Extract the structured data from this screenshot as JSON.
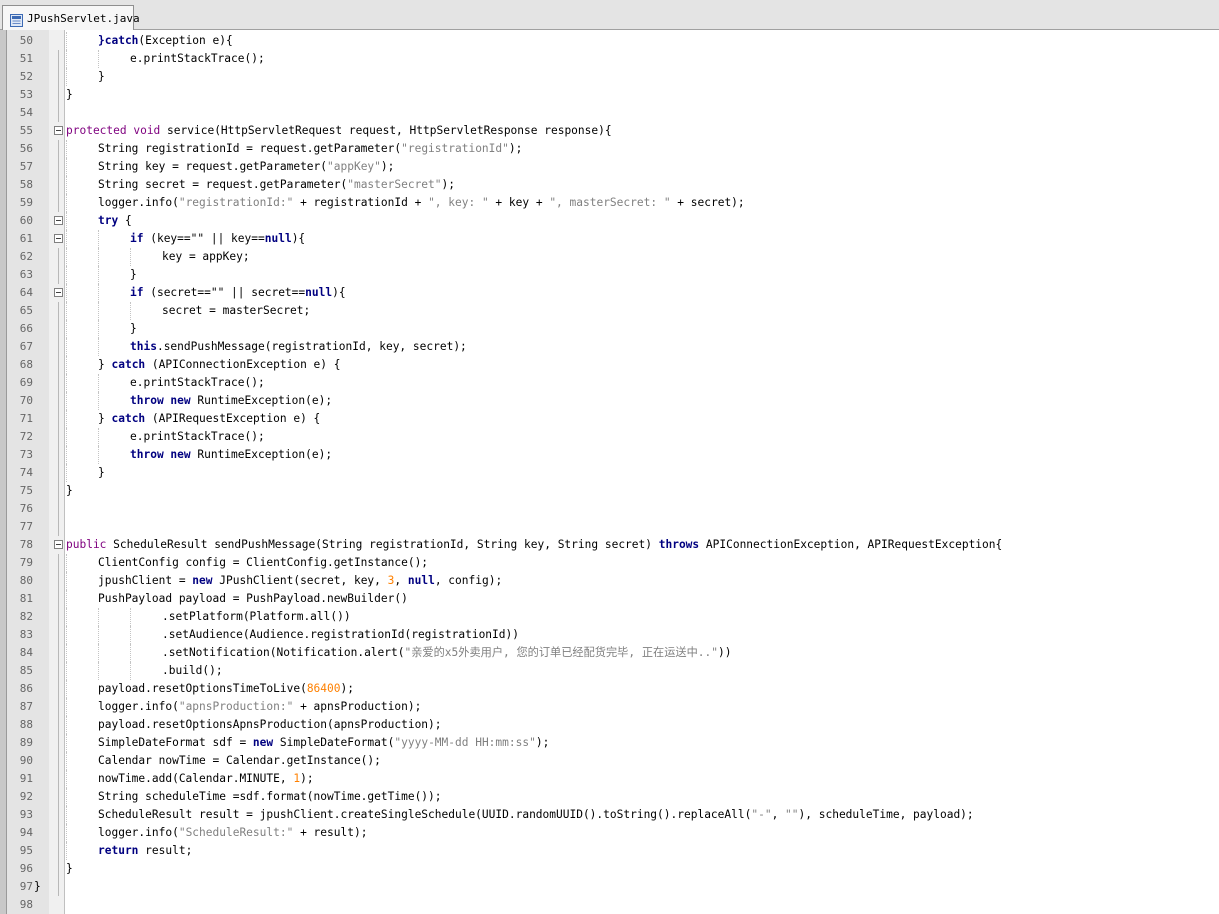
{
  "tab": {
    "label": "JPushServlet.java",
    "icon": "java-file-icon"
  },
  "colors": {
    "keyword": "#000080",
    "modifier": "#7f007f",
    "string": "#808080",
    "number": "#ff8000"
  },
  "lines": [
    {
      "num": "50",
      "indent": 2,
      "segments": [
        [
          "k",
          "}catch"
        ],
        [
          "",
          "(Exception e){"
        ]
      ]
    },
    {
      "num": "51",
      "indent": 3,
      "segments": [
        [
          "",
          "e.printStackTrace();"
        ]
      ]
    },
    {
      "num": "52",
      "indent": 2,
      "segments": [
        [
          "",
          "}"
        ]
      ]
    },
    {
      "num": "53",
      "indent": 1,
      "segments": [
        [
          "",
          "}"
        ]
      ]
    },
    {
      "num": "54",
      "indent": 0,
      "segments": []
    },
    {
      "num": "55",
      "indent": 1,
      "fold": true,
      "segments": [
        [
          "p",
          "protected void "
        ],
        [
          "",
          "service(HttpServletRequest request, HttpServletResponse response){"
        ]
      ]
    },
    {
      "num": "56",
      "indent": 2,
      "segments": [
        [
          "",
          "String registrationId = request.getParameter("
        ],
        [
          "s",
          "\"registrationId\""
        ],
        [
          "",
          ");"
        ]
      ]
    },
    {
      "num": "57",
      "indent": 2,
      "segments": [
        [
          "",
          "String key = request.getParameter("
        ],
        [
          "s",
          "\"appKey\""
        ],
        [
          "",
          ");"
        ]
      ]
    },
    {
      "num": "58",
      "indent": 2,
      "segments": [
        [
          "",
          "String secret = request.getParameter("
        ],
        [
          "s",
          "\"masterSecret\""
        ],
        [
          "",
          ");"
        ]
      ]
    },
    {
      "num": "59",
      "indent": 2,
      "segments": [
        [
          "",
          "logger.info("
        ],
        [
          "s",
          "\"registrationId:\""
        ],
        [
          "",
          " + registrationId + "
        ],
        [
          "s",
          "\", key: \""
        ],
        [
          "",
          " + key + "
        ],
        [
          "s",
          "\", masterSecret: \""
        ],
        [
          "",
          " + secret);"
        ]
      ]
    },
    {
      "num": "60",
      "indent": 2,
      "fold": true,
      "segments": [
        [
          "k",
          "try"
        ],
        [
          "",
          " {"
        ]
      ]
    },
    {
      "num": "61",
      "indent": 3,
      "fold": true,
      "segments": [
        [
          "k",
          "if"
        ],
        [
          "",
          " (key==\"\" || key=="
        ],
        [
          "k",
          "null"
        ],
        [
          "",
          "){"
        ]
      ]
    },
    {
      "num": "62",
      "indent": 4,
      "segments": [
        [
          "",
          "key = appKey;"
        ]
      ]
    },
    {
      "num": "63",
      "indent": 3,
      "segments": [
        [
          "",
          "}"
        ]
      ]
    },
    {
      "num": "64",
      "indent": 3,
      "fold": true,
      "segments": [
        [
          "k",
          "if"
        ],
        [
          "",
          " (secret==\"\" || secret=="
        ],
        [
          "k",
          "null"
        ],
        [
          "",
          "){"
        ]
      ]
    },
    {
      "num": "65",
      "indent": 4,
      "segments": [
        [
          "",
          "secret = masterSecret;"
        ]
      ]
    },
    {
      "num": "66",
      "indent": 3,
      "segments": [
        [
          "",
          "}"
        ]
      ]
    },
    {
      "num": "67",
      "indent": 3,
      "segments": [
        [
          "k",
          "this"
        ],
        [
          "",
          ".sendPushMessage(registrationId, key, secret);"
        ]
      ]
    },
    {
      "num": "68",
      "indent": 2,
      "segments": [
        [
          "",
          "} "
        ],
        [
          "k",
          "catch"
        ],
        [
          "",
          " (APIConnectionException e) {"
        ]
      ]
    },
    {
      "num": "69",
      "indent": 3,
      "segments": [
        [
          "",
          "e.printStackTrace();"
        ]
      ]
    },
    {
      "num": "70",
      "indent": 3,
      "segments": [
        [
          "k",
          "throw new "
        ],
        [
          "",
          "RuntimeException(e);"
        ]
      ]
    },
    {
      "num": "71",
      "indent": 2,
      "segments": [
        [
          "",
          "} "
        ],
        [
          "k",
          "catch"
        ],
        [
          "",
          " (APIRequestException e) {"
        ]
      ]
    },
    {
      "num": "72",
      "indent": 3,
      "segments": [
        [
          "",
          "e.printStackTrace();"
        ]
      ]
    },
    {
      "num": "73",
      "indent": 3,
      "segments": [
        [
          "k",
          "throw new "
        ],
        [
          "",
          "RuntimeException(e);"
        ]
      ]
    },
    {
      "num": "74",
      "indent": 2,
      "segments": [
        [
          "",
          "}"
        ]
      ]
    },
    {
      "num": "75",
      "indent": 1,
      "segments": [
        [
          "",
          "}"
        ]
      ]
    },
    {
      "num": "76",
      "indent": 0,
      "segments": []
    },
    {
      "num": "77",
      "indent": 0,
      "segments": []
    },
    {
      "num": "78",
      "indent": 1,
      "fold": true,
      "segments": [
        [
          "p",
          "public "
        ],
        [
          "",
          "ScheduleResult sendPushMessage(String registrationId, String key, String secret) "
        ],
        [
          "k",
          "throws"
        ],
        [
          "",
          " APIConnectionException, APIRequestException{"
        ]
      ]
    },
    {
      "num": "79",
      "indent": 2,
      "segments": [
        [
          "",
          "ClientConfig config = ClientConfig.getInstance();"
        ]
      ]
    },
    {
      "num": "80",
      "indent": 2,
      "segments": [
        [
          "",
          "jpushClient = "
        ],
        [
          "k",
          "new"
        ],
        [
          "",
          " JPushClient(secret, key, "
        ],
        [
          "n",
          "3"
        ],
        [
          "",
          ", "
        ],
        [
          "k",
          "null"
        ],
        [
          "",
          ", config);"
        ]
      ]
    },
    {
      "num": "81",
      "indent": 2,
      "segments": [
        [
          "",
          "PushPayload payload = PushPayload.newBuilder()"
        ]
      ]
    },
    {
      "num": "82",
      "indent": 4,
      "segments": [
        [
          "",
          ".setPlatform(Platform.all())"
        ]
      ]
    },
    {
      "num": "83",
      "indent": 4,
      "segments": [
        [
          "",
          ".setAudience(Audience.registrationId(registrationId))"
        ]
      ]
    },
    {
      "num": "84",
      "indent": 4,
      "segments": [
        [
          "",
          ".setNotification(Notification.alert("
        ],
        [
          "s",
          "\"亲爱的x5外卖用户, 您的订单已经配货完毕, 正在运送中..\""
        ],
        [
          "",
          "))"
        ]
      ]
    },
    {
      "num": "85",
      "indent": 4,
      "segments": [
        [
          "",
          ".build();"
        ]
      ]
    },
    {
      "num": "86",
      "indent": 2,
      "segments": [
        [
          "",
          "payload.resetOptionsTimeToLive("
        ],
        [
          "n",
          "86400"
        ],
        [
          "",
          ");"
        ]
      ]
    },
    {
      "num": "87",
      "indent": 2,
      "segments": [
        [
          "",
          "logger.info("
        ],
        [
          "s",
          "\"apnsProduction:\""
        ],
        [
          "",
          " + apnsProduction);"
        ]
      ]
    },
    {
      "num": "88",
      "indent": 2,
      "segments": [
        [
          "",
          "payload.resetOptionsApnsProduction(apnsProduction);"
        ]
      ]
    },
    {
      "num": "89",
      "indent": 2,
      "segments": [
        [
          "",
          "SimpleDateFormat sdf = "
        ],
        [
          "k",
          "new"
        ],
        [
          "",
          " SimpleDateFormat("
        ],
        [
          "s",
          "\"yyyy-MM-dd HH:mm:ss\""
        ],
        [
          "",
          ");"
        ]
      ]
    },
    {
      "num": "90",
      "indent": 2,
      "segments": [
        [
          "",
          "Calendar nowTime = Calendar.getInstance();"
        ]
      ]
    },
    {
      "num": "91",
      "indent": 2,
      "segments": [
        [
          "",
          "nowTime.add(Calendar.MINUTE, "
        ],
        [
          "n",
          "1"
        ],
        [
          "",
          ");"
        ]
      ]
    },
    {
      "num": "92",
      "indent": 2,
      "segments": [
        [
          "",
          "String scheduleTime =sdf.format(nowTime.getTime());"
        ]
      ]
    },
    {
      "num": "93",
      "indent": 2,
      "segments": [
        [
          "",
          "ScheduleResult result = jpushClient.createSingleSchedule(UUID.randomUUID().toString().replaceAll("
        ],
        [
          "s",
          "\"-\""
        ],
        [
          "",
          ", "
        ],
        [
          "s",
          "\"\""
        ],
        [
          "",
          "), scheduleTime, payload);"
        ]
      ]
    },
    {
      "num": "94",
      "indent": 2,
      "segments": [
        [
          "",
          "logger.info("
        ],
        [
          "s",
          "\"ScheduleResult:\""
        ],
        [
          "",
          " + result);"
        ]
      ]
    },
    {
      "num": "95",
      "indent": 2,
      "segments": [
        [
          "k",
          "return"
        ],
        [
          "",
          " result;"
        ]
      ]
    },
    {
      "num": "96",
      "indent": 1,
      "segments": [
        [
          "",
          "}"
        ]
      ]
    },
    {
      "num": "97",
      "indent": 0,
      "segments": [
        [
          "",
          "}"
        ]
      ]
    },
    {
      "num": "98",
      "indent": 0,
      "segments": []
    }
  ]
}
